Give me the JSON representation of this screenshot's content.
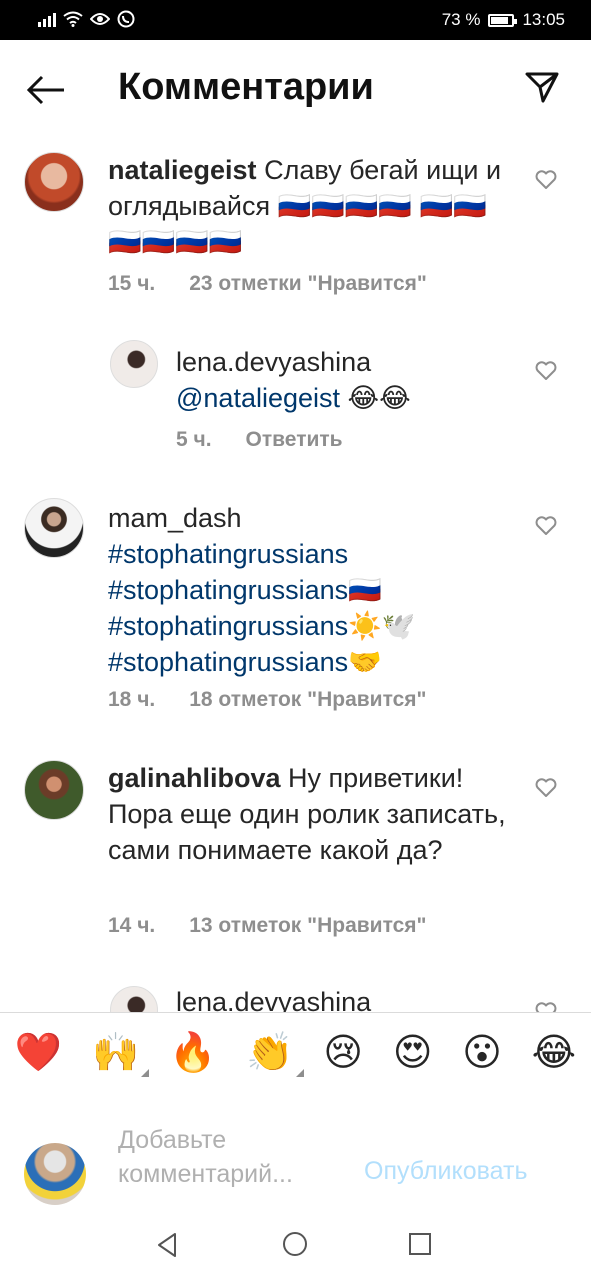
{
  "status_bar": {
    "battery": "73 %",
    "battery_level": 0.73,
    "time": "13:05"
  },
  "header": {
    "title": "Комментарии"
  },
  "comments": [
    {
      "username": "nataliegeist",
      "text": " Славу бегай ищи и оглядывайся 🇷🇺🇷🇺🇷🇺🇷🇺 🇷🇺🇷🇺🇷🇺🇷🇺🇷🇺🇷🇺",
      "time": "15 ч.",
      "likes": "23 отметки \"Нравится\""
    },
    {
      "username": "lena.devyashina",
      "mention": "@nataliegeist",
      "text": " 😂😂",
      "time": "5 ч.",
      "reply": "Ответить"
    },
    {
      "username": "mam_dash",
      "lines": [
        "#stophatingrussians",
        "#stophatingrussians🇷🇺",
        "#stophatingrussians☀️🕊️",
        "#stophatingrussians🤝"
      ],
      "time": "18 ч.",
      "likes": "18 отметок \"Нравится\""
    },
    {
      "username": "galinahlibova",
      "text": " Ну приветики! Пора еще один ролик записать, сами понимаете какой да?",
      "time": "14 ч.",
      "likes": "13 отметок \"Нравится\""
    },
    {
      "username": "lena.devyashina"
    }
  ],
  "reactions": [
    "❤️",
    "🙌",
    "🔥",
    "👏",
    "😢",
    "😍",
    "😮",
    "😂"
  ],
  "input": {
    "placeholder": "Добавьте комментарий...",
    "publish": "Опубликовать"
  },
  "colors": {
    "accent": "#0095f6",
    "publish_disabled": "#b2dffc",
    "meta": "#8e8e8e",
    "hashtag": "#00376b"
  }
}
